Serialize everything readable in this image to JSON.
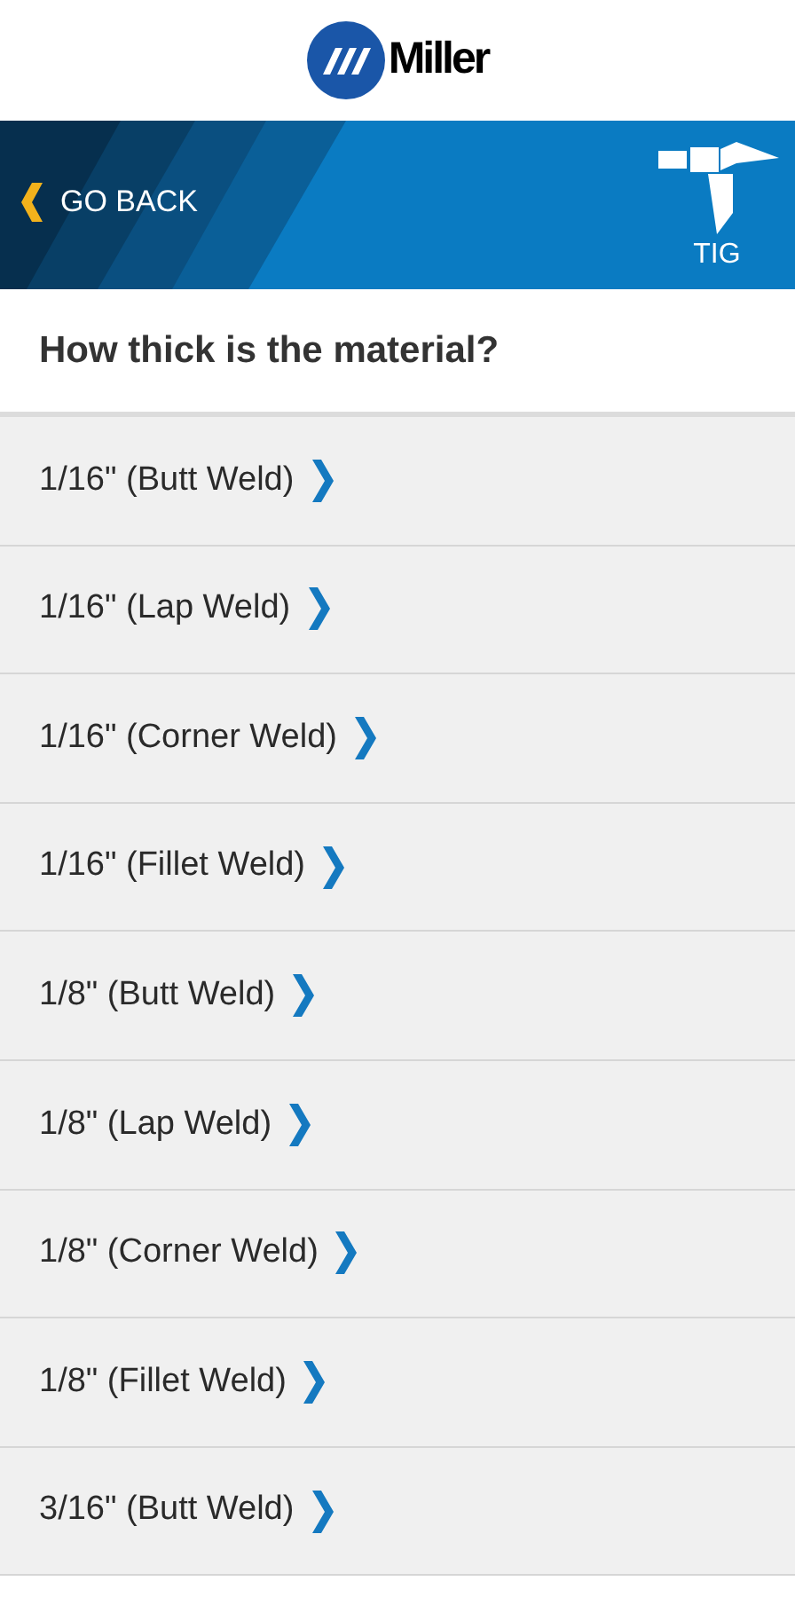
{
  "header": {
    "logo_text": "Miller"
  },
  "banner": {
    "back_label": "GO BACK",
    "process": "TIG"
  },
  "question": "How thick is the material?",
  "options": [
    {
      "label": "1/16\" (Butt Weld)"
    },
    {
      "label": "1/16\" (Lap Weld)"
    },
    {
      "label": "1/16\" (Corner Weld)"
    },
    {
      "label": "1/16\" (Fillet Weld)"
    },
    {
      "label": "1/8\" (Butt Weld)"
    },
    {
      "label": "1/8\" (Lap Weld)"
    },
    {
      "label": "1/8\" (Corner Weld)"
    },
    {
      "label": "1/8\" (Fillet Weld)"
    },
    {
      "label": "3/16\" (Butt Weld)"
    }
  ]
}
